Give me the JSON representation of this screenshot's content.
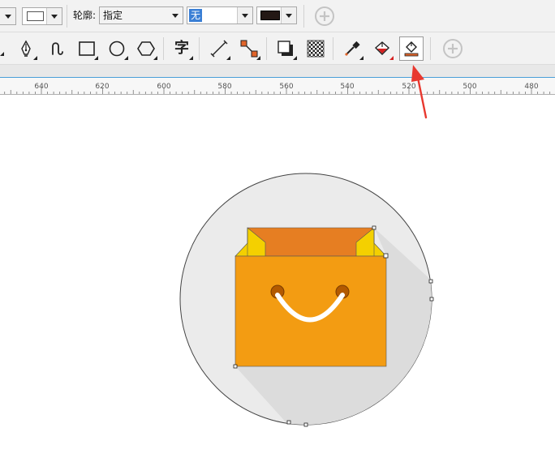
{
  "property_bar": {
    "outline_label": "轮廓:",
    "outline_style_value": "指定",
    "fill_value": "无",
    "outline_color": "#231815",
    "add_icon": "plus-circle-icon"
  },
  "toolbox": {
    "tools": [
      {
        "name": "pen-tool",
        "icon": "pen-nib-icon"
      },
      {
        "name": "artistic-media-tool",
        "icon": "curve-icon"
      },
      {
        "name": "rectangle-tool",
        "icon": "rectangle-icon"
      },
      {
        "name": "ellipse-tool",
        "icon": "ellipse-icon"
      },
      {
        "name": "polygon-tool",
        "icon": "hexagon-icon"
      },
      {
        "name": "text-tool",
        "icon": "text-icon",
        "glyph": "字"
      },
      {
        "name": "parallel-dimension-tool",
        "icon": "dimension-line-icon"
      },
      {
        "name": "connector-tool",
        "icon": "connector-icon"
      },
      {
        "name": "drop-shadow-tool",
        "icon": "drop-shadow-icon"
      },
      {
        "name": "transparency-tool",
        "icon": "checkerboard-icon"
      },
      {
        "name": "color-eyedropper-tool",
        "icon": "eyedropper-icon"
      },
      {
        "name": "interactive-fill-tool",
        "icon": "paint-bucket-icon"
      },
      {
        "name": "smart-fill-tool",
        "icon": "smart-fill-icon",
        "active": true
      }
    ],
    "add_icon": "plus-circle-icon"
  },
  "ruler": {
    "labels": [
      "640",
      "620",
      "600",
      "580",
      "560",
      "540",
      "520",
      "500",
      "480"
    ]
  },
  "colors": {
    "circle_bg": "#ebebeb",
    "long_shadow": "#dcdcdc",
    "bag_body": "#f39c12",
    "bag_back": "#e67e22",
    "bag_side": "#f4d000",
    "handle": "#ffffff",
    "handle_hole": "#b35a00",
    "arrow": "#e8382f"
  }
}
